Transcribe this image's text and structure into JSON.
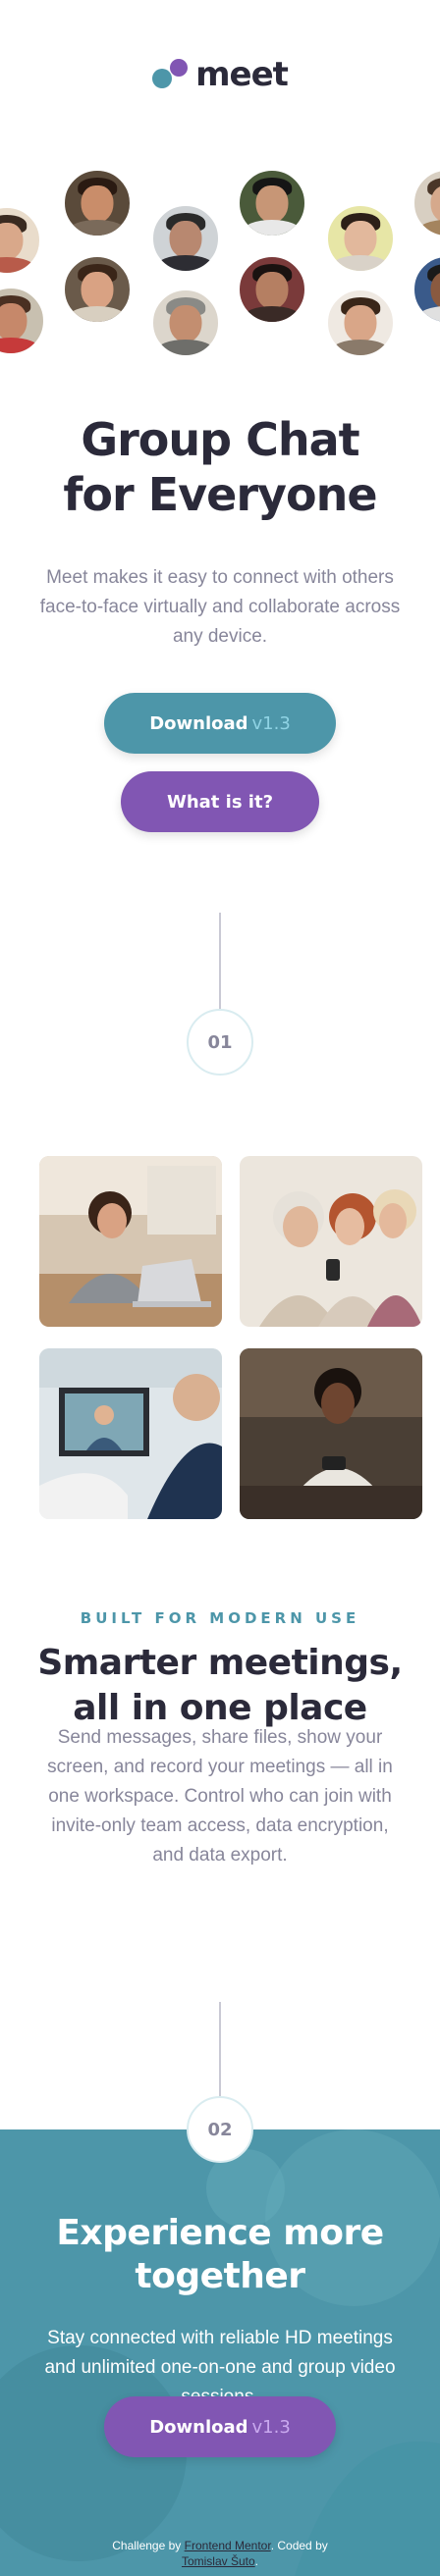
{
  "brand": {
    "name": "meet"
  },
  "hero": {
    "title_line1": "Group Chat",
    "title_line2": "for Everyone",
    "text": "Meet makes it easy to connect with others face-to-face virtually and collaborate across any device.",
    "download_label": "Download",
    "download_version": "v1.3",
    "what_label": "What is it?"
  },
  "step1": {
    "number": "01"
  },
  "features": {
    "eyebrow": "BUILT FOR MODERN USE",
    "title_line1": "Smarter meetings,",
    "title_line2": "all in one place",
    "text": "Send messages, share files, show your screen, and record your meetings — all in one workspace. Control who can join with invite-only team access, data encryption, and data export."
  },
  "step2": {
    "number": "02"
  },
  "cta": {
    "title_line1": "Experience more",
    "title_line2": "together",
    "text": "Stay connected with reliable HD meetings and unlimited one-on-one and group video sessions.",
    "download_label": "Download",
    "download_version": "v1.3"
  },
  "attribution": {
    "prefix": "Challenge by",
    "link1": "Frontend Mentor",
    "middle": ". Coded by",
    "link2": "Tomislav Šuto",
    "suffix": "."
  },
  "colors": {
    "teal": "#4d96a9",
    "purple": "#8156b3",
    "dark": "#2b2a3a",
    "gray": "#87869a"
  }
}
